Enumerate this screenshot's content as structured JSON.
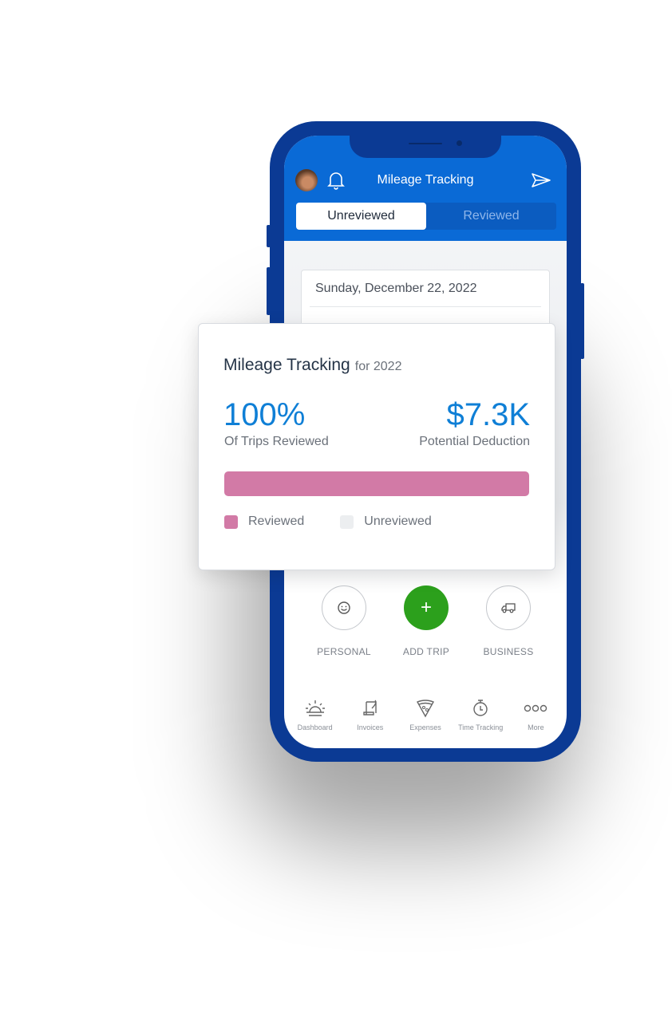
{
  "app": {
    "header_title": "Mileage Tracking",
    "accent_color": "#0a6ad6",
    "icons": {
      "avatar": "user-avatar",
      "bell": "bell-icon",
      "send": "send-icon"
    }
  },
  "tabs": [
    {
      "label": "Unreviewed",
      "active": true
    },
    {
      "label": "Reviewed",
      "active": false
    }
  ],
  "trip_card": {
    "date": "Sunday, December 22, 2022"
  },
  "summary": {
    "title": "Mileage Tracking",
    "period": "for 2022",
    "reviewed_percent_value": "100%",
    "reviewed_percent_label": "Of Trips Reviewed",
    "deduction_value": "$7.3K",
    "deduction_label": "Potential Deduction",
    "progress_reviewed_fraction": 1.0,
    "legend": [
      {
        "label": "Reviewed",
        "color": "#d27aa6"
      },
      {
        "label": "Unreviewed",
        "color": "#eceef0"
      }
    ]
  },
  "actions": [
    {
      "label": "PERSONAL",
      "icon": "smiley-icon"
    },
    {
      "label": "ADD TRIP",
      "icon": "plus-icon",
      "color": "#2ca01c"
    },
    {
      "label": "BUSINESS",
      "icon": "truck-icon"
    }
  ],
  "tabbar": [
    {
      "label": "Dashboard",
      "icon": "sunrise-icon"
    },
    {
      "label": "Invoices",
      "icon": "scroll-quill-icon"
    },
    {
      "label": "Expenses",
      "icon": "pizza-slice-icon"
    },
    {
      "label": "Time Tracking",
      "icon": "stopwatch-icon"
    },
    {
      "label": "More",
      "icon": "more-dots-icon"
    }
  ]
}
